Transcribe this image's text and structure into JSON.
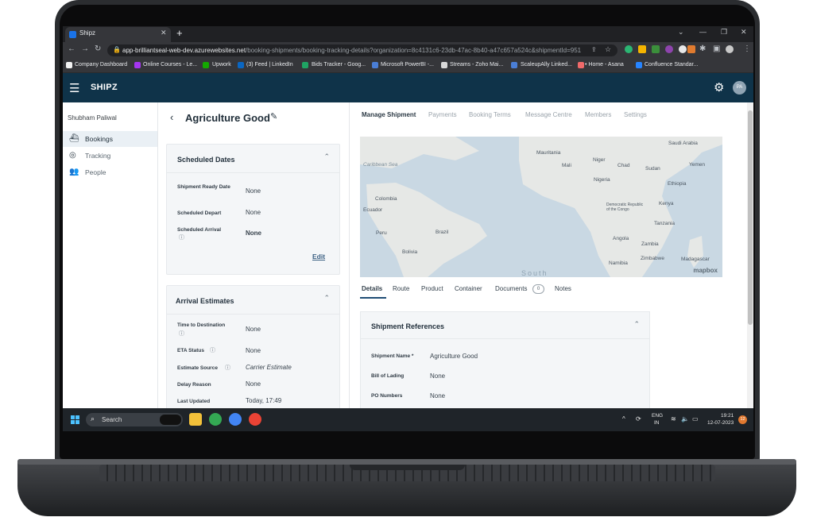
{
  "browser": {
    "tab_title": "Shipz",
    "tab_close": "✕",
    "new_tab": "+",
    "url_host": "app-brilliantseal-web-dev.azurewebsites.net",
    "url_path": "/booking-shipments/booking-tracking-details?organization=8c4131c6-23db-47ac-8b40-a47c657a524c&shipmentId=951",
    "bookmarks": [
      {
        "label": "Company Dashboard",
        "color": "#f2f2f2"
      },
      {
        "label": "Online Courses - Le...",
        "color": "#a435f0"
      },
      {
        "label": "Upwork",
        "color": "#14a800"
      },
      {
        "label": "(3) Feed | LinkedIn",
        "color": "#0a66c2"
      },
      {
        "label": "Bids Tracker - Goog...",
        "color": "#1fa463"
      },
      {
        "label": "Microsoft PowerBI -...",
        "color": "#4a7ed6"
      },
      {
        "label": "Streams - Zoho Mai...",
        "color": "#d8d8d8"
      },
      {
        "label": "ScaleupAlly Linked...",
        "color": "#4a7ed6"
      },
      {
        "label": "• Home - Asana",
        "color": "#f06a6a"
      },
      {
        "label": "Confluence Standar...",
        "color": "#2684ff"
      }
    ]
  },
  "app": {
    "brand": "SHIPZ",
    "avatar": "PA",
    "accent": "#0f3349"
  },
  "sidebar": {
    "user_name": "Shubham Paliwal",
    "items": [
      {
        "label": "Bookings",
        "icon": "ship-icon"
      },
      {
        "label": "Tracking",
        "icon": "tracking-icon"
      },
      {
        "label": "People",
        "icon": "people-icon"
      }
    ]
  },
  "shipment": {
    "title": "Agriculture Good"
  },
  "scheduled_dates": {
    "title": "Scheduled Dates",
    "fields": [
      {
        "label": "Shipment Ready Date",
        "value": "None"
      },
      {
        "label": "Scheduled Depart",
        "value": "None"
      },
      {
        "label": "Scheduled Arrival",
        "value": "None"
      }
    ],
    "edit": "Edit"
  },
  "arrival_estimates": {
    "title": "Arrival Estimates",
    "fields": [
      {
        "label": "Time to Destination",
        "value": "None"
      },
      {
        "label": "ETA Status",
        "value": "None"
      },
      {
        "label": "Estimate Source",
        "value": "Carrier Estimate"
      },
      {
        "label": "Delay Reason",
        "value": "None"
      },
      {
        "label": "Last Updated",
        "value": "Today, 17:49"
      }
    ]
  },
  "top_tabs": [
    "Manage Shipment",
    "Payments",
    "Booking Terms",
    "Message Centre",
    "Members",
    "Settings"
  ],
  "map": {
    "labels": [
      "Saudi Arabia",
      "Mauritania",
      "Mali",
      "Niger",
      "Chad",
      "Sudan",
      "Yemen",
      "Caribbean Sea",
      "Nigeria",
      "Ethiopia",
      "Colombia",
      "Ecuador",
      "Democratic Republic of the Congo",
      "Kenya",
      "Brazil",
      "Peru",
      "Tanzania",
      "Angola",
      "Bolivia",
      "Zambia",
      "Zimbabwe",
      "Namibia",
      "Madagascar",
      "South"
    ],
    "logo": "mapbox"
  },
  "sub_tabs": [
    "Details",
    "Route",
    "Product",
    "Container",
    "Documents",
    "Notes"
  ],
  "documents_count": "0",
  "shipment_references": {
    "title": "Shipment References",
    "fields": [
      {
        "label": "Shipment Name *",
        "value": "Agriculture Good"
      },
      {
        "label": "Bill of Lading",
        "value": "None"
      },
      {
        "label": "PO Numbers",
        "value": "None"
      }
    ]
  },
  "taskbar": {
    "search_placeholder": "Search",
    "lang_line1": "ENG",
    "lang_line2": "IN",
    "time": "19:21",
    "date": "12-07-2023",
    "notification_count": "12"
  }
}
